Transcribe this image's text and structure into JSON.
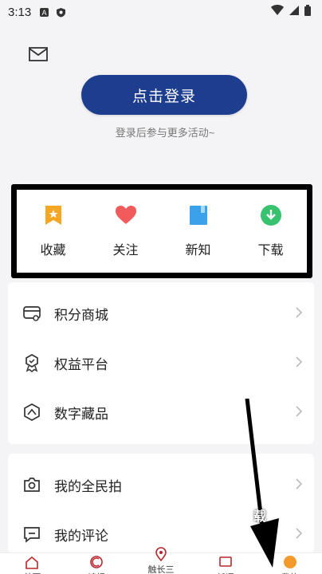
{
  "status": {
    "time": "3:13"
  },
  "login": {
    "button_label": "点击登录",
    "hint": "登录后参与更多活动~"
  },
  "quick_actions": [
    {
      "label": "收藏",
      "icon": "bookmark-icon",
      "color": "#f5a623"
    },
    {
      "label": "关注",
      "icon": "heart-icon",
      "color": "#f25b5b"
    },
    {
      "label": "新知",
      "icon": "book-icon",
      "color": "#3aa1ea"
    },
    {
      "label": "下载",
      "icon": "download-icon",
      "color": "#36c26f"
    }
  ],
  "menu_group_1": [
    {
      "label": "积分商城",
      "icon": "shop-icon"
    },
    {
      "label": "权益平台",
      "icon": "badge-icon"
    },
    {
      "label": "数字藏品",
      "icon": "collection-icon"
    }
  ],
  "menu_group_2": [
    {
      "label": "我的全民拍",
      "icon": "camera-icon"
    },
    {
      "label": "我的评论",
      "icon": "comment-icon"
    }
  ],
  "tabbar": [
    {
      "label": "首页",
      "icon": "home-icon"
    },
    {
      "label": "读报",
      "icon": "newspaper-icon"
    },
    {
      "label": "触长三",
      "icon": "location-icon"
    },
    {
      "label": "新语",
      "icon": "chat-icon"
    },
    {
      "label": "我的",
      "icon": "profile-icon"
    }
  ],
  "overlay_text": "载"
}
